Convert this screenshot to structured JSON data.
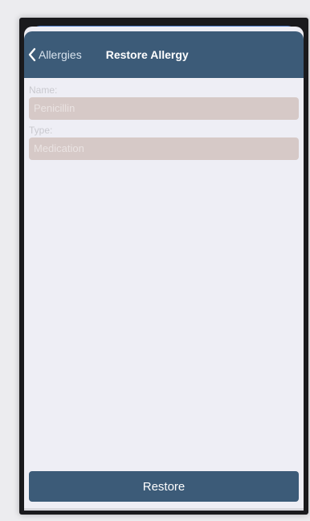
{
  "navbar": {
    "back_label": "Allergies",
    "title": "Restore Allergy"
  },
  "form": {
    "name": {
      "label": "Name:",
      "value": "Penicillin"
    },
    "type": {
      "label": "Type:",
      "value": "Medication"
    }
  },
  "actions": {
    "restore_label": "Restore"
  },
  "colors": {
    "navbar": "#3c5b78",
    "button": "#3c5b78",
    "field_background": "#d6c9c7",
    "screen_background": "#eeeef5",
    "sheet_accent": "#4a78c4"
  },
  "icons": {
    "back": "chevron-left-icon"
  }
}
